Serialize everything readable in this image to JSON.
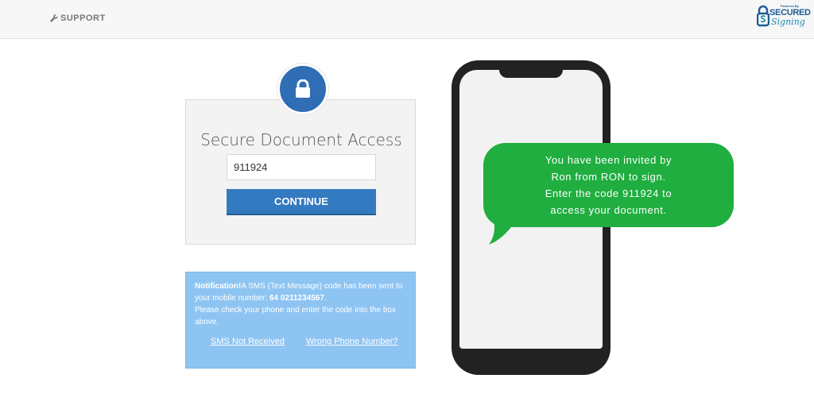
{
  "header": {
    "support_label": "SUPPORT",
    "brand": {
      "powered": "Powered By",
      "secured": "SECURED",
      "signing": "Signing"
    }
  },
  "access_card": {
    "title": "Secure Document Access",
    "code_value": "911924",
    "continue_label": "CONTINUE"
  },
  "notification": {
    "label": "Notification!",
    "message_part1": "A SMS (Text Message) code has been sent to your mobile number: ",
    "phone_number": "64 0211234567",
    "message_part2": ".",
    "instruction": "Please check your phone and enter the code into the box above.",
    "link_sms_not_received": "SMS Not Received",
    "link_wrong_phone": "Wrong Phone Number?"
  },
  "sms_bubble": {
    "lines": [
      "You have been invited by",
      "Ron from RON to sign.",
      "Enter the code 911924 to",
      "access your document."
    ]
  },
  "colors": {
    "primary_blue": "#347ac0",
    "notification_blue": "#8ec4f2",
    "bubble_green": "#1fae3f",
    "phone_body": "#222222"
  },
  "icons": [
    "wrench-icon",
    "lock-icon",
    "secured-signing-logo"
  ]
}
